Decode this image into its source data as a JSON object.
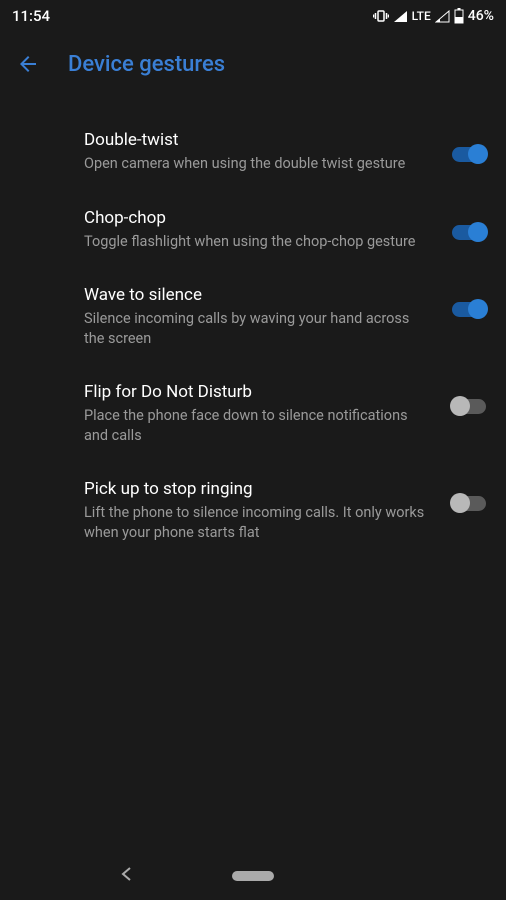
{
  "status": {
    "time": "11:54",
    "network": "LTE",
    "battery": "46%"
  },
  "header": {
    "title": "Device gestures"
  },
  "settings": [
    {
      "title": "Double-twist",
      "desc": "Open camera when using the double twist gesture",
      "enabled": true
    },
    {
      "title": "Chop-chop",
      "desc": "Toggle flashlight when using the chop-chop gesture",
      "enabled": true
    },
    {
      "title": "Wave to silence",
      "desc": "Silence incoming calls by waving your hand across the screen",
      "enabled": true
    },
    {
      "title": "Flip for Do Not Disturb",
      "desc": "Place the phone face down to silence notifications and calls",
      "enabled": false
    },
    {
      "title": "Pick up to stop ringing",
      "desc": "Lift the phone to silence incoming calls. It only works when your phone starts flat",
      "enabled": false
    }
  ]
}
